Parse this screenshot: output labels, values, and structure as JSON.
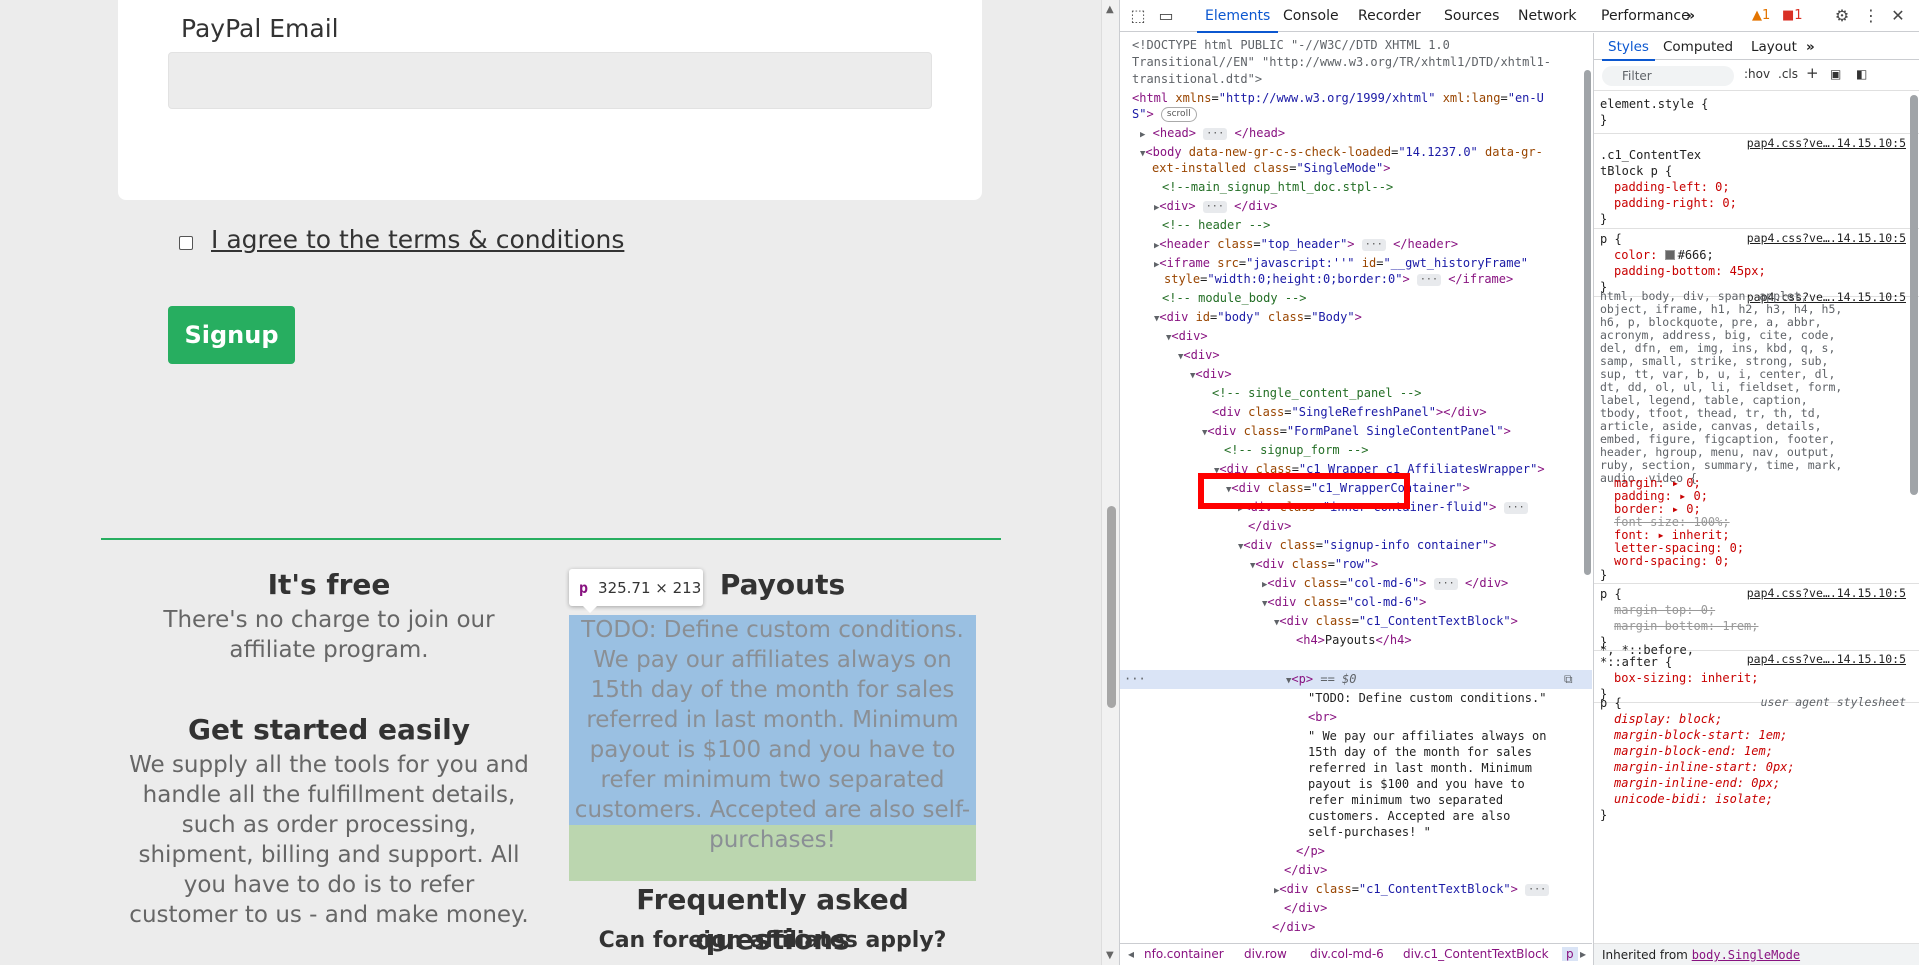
{
  "page": {
    "paypal_label": "PayPal Email",
    "paypal_value": "",
    "agree_text": "I agree to the terms & conditions",
    "signup_label": "Signup",
    "free_title": "It's free",
    "free_text": "There's no charge to join our affiliate program.",
    "started_title": "Get started easily",
    "started_text": "We supply all the tools for you and handle all the fulfillment details, such as order processing, shipment, billing and support. All you have to do is to refer customer to us - and make money.",
    "payouts_title": "Payouts",
    "payouts_text": "TODO: Define custom conditions. We pay our affiliates always on 15th day of the month for sales referred in last month. Minimum payout is $100 and you have to refer minimum two separated customers. Accepted are also self-purchases!",
    "faq_title": "Frequently asked questions",
    "faq_q1": "Can foreign affiliates apply?",
    "tooltip_tag": "p",
    "tooltip_size": "325.71 × 213"
  },
  "devtools": {
    "tabs": [
      "Elements",
      "Console",
      "Recorder",
      "Sources",
      "Network",
      "Performance"
    ],
    "active_tab": "Elements",
    "more_tabs": "»",
    "warnings": "1",
    "errors": "1",
    "styles_tabs": [
      "Styles",
      "Computed",
      "Layout"
    ],
    "styles_more": "»",
    "filter_placeholder": "Filter",
    "hov": ":hov",
    "cls": ".cls",
    "dom": {
      "l1": "<!DOCTYPE html PUBLIC \"-//W3C//DTD XHTML 1.0",
      "l2": "Transitional//EN\" \"http://www.w3.org/TR/xhtml1/DTD/xhtml1-",
      "l3": "transitional.dtd\">",
      "html_lang_a": "\"en-U",
      "html_lang_b": "S\"",
      "scroll_pill": "scroll",
      "body_loaded": "\"14.1237.0\"",
      "body_class": "\"SingleMode\"",
      "c_main": "<!--main_signup_html_doc.stpl-->",
      "c_header": "<!-- header -->",
      "header_class": "\"top_header\"",
      "iframe_src": "\"javascript:''\"",
      "iframe_id": "\"__gwt_historyFrame\"",
      "iframe_style": "\"width:0;height:0;border:0\"",
      "c_module": "<!-- module_body -->",
      "body_id": "\"body\"",
      "body_cls": "\"Body\"",
      "c_single": "<!--    single_content_panel    -->",
      "srp": "\"SingleRefreshPanel\"",
      "fp": "\"FormPanel SingleContentPanel\"",
      "c_signup": "<!-- signup_form -->",
      "wrapper": "\"c1_Wrapper c1_AffiliatesWrapper\"",
      "wrapcont": "\"c1_WrapperContainer\"",
      "inner": "\"inner container-fluid\"",
      "signupinfo": "\"signup-info container\"",
      "row": "\"row\"",
      "col": "\"col-md-6\"",
      "ctb": "\"c1_ContentTextBlock\"",
      "h4_text": "Payouts",
      "sel_marker": "== $0",
      "todo": "\"TODO: Define custom conditions.\"",
      "p_text": [
        "\" We pay our affiliates always on",
        "15th day of the month for sales",
        "referred in last month. Minimum",
        "payout is $100 and you have to",
        "refer minimum two separated",
        "customers. Accepted are also",
        "self-purchases! \""
      ]
    },
    "breadcrumbs": [
      "nfo.container",
      "div.row",
      "div.col-md-6",
      "div.c1_ContentTextBlock",
      "p"
    ],
    "styles": {
      "element_style": "element.style {",
      "src_all": "pap4.css?ve….14.15.10:5",
      "r1_sel_a": ".c1_ContentTex",
      "r1_sel_b": "tBlock p {",
      "r1_p1": "padding-left: 0;",
      "r1_p2": "padding-right: 0;",
      "r2_sel": "p {",
      "r2_color": "#666;",
      "r2_pb": "padding-bottom: 45px;",
      "reset_sel": "html, body, div, span, applet, object, iframe, h1, h2, h3, h4, h5, h6, p, blockquote, pre, a, abbr, acronym, address, big, cite, code, del, dfn, em, img, ins, kbd, q, s, samp, small, strike, strong, sub, sup, tt, var, b, u, i, center, dl, dt, dd, ol, ul, li, fieldset, form, label, legend, table, caption, tbody, tfoot, thead, tr, th, td, article, aside, canvas, details, embed, figure, figcaption, footer, header, hgroup, menu, nav, output, ruby, section, summary, time, mark, audio, video {",
      "reset_props": [
        "margin: ▸ 0;",
        "padding: ▸ 0;",
        "border: ▸ 0;",
        "font-size: 100%;",
        "font: ▸ inherit;",
        "letter-spacing: 0;",
        "word-spacing: 0;"
      ],
      "r4_p1": "margin-top: 0;",
      "r4_p2": "margin-bottom: 1rem;",
      "r5_sel": "*, *::before,",
      "r5_sel2": "*::after {",
      "r5_p": "box-sizing: inherit;",
      "ua_label": "user agent stylesheet",
      "ua_props": [
        "display: block;",
        "margin-block-start: 1em;",
        "margin-block-end: 1em;",
        "margin-inline-start: 0px;",
        "margin-inline-end: 0px;",
        "unicode-bidi: isolate;"
      ],
      "inherited_from": "Inherited from",
      "inherited_el": "body.SingleMode"
    }
  },
  "colors": {
    "accent_green": "#27ae60",
    "devtools_blue": "#0b57d0",
    "highlight_content": "#6fa8dc",
    "highlight_padding": "#93c47d",
    "red_annotation": "#ff0000"
  }
}
